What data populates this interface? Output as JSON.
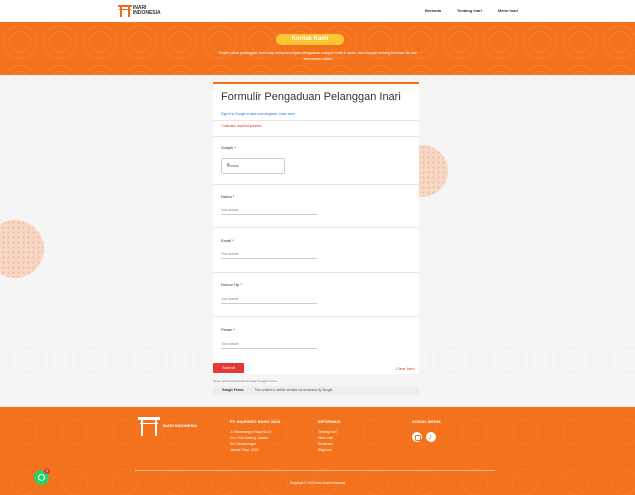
{
  "brand": {
    "name": "INARI INDONESIA"
  },
  "nav": {
    "items": [
      "Beranda",
      "Tentang Inari",
      "Menu Inari"
    ]
  },
  "hero": {
    "title": "Kontak Kami",
    "subtitle": "Sugeh untuk pelanggan, kami siap melayani segala pengaduan maupun kritik & saran, kami sangat senang bertukar ide dan komunikasi dalam"
  },
  "form": {
    "title": "Formulir Pengaduan Pelanggan Inari",
    "signin_text": "Sign in to Google to save your progress. Learn more",
    "required_note": "* Indicates required question",
    "questions": [
      {
        "label": "Subjek *",
        "placeholder": "Choose"
      },
      {
        "label": "Nama *",
        "placeholder": "Your answer"
      },
      {
        "label": "Email *",
        "placeholder": "Your answer"
      },
      {
        "label": "Nomor Hp *",
        "placeholder": "Your answer"
      },
      {
        "label": "Pesan *",
        "placeholder": "Your answer"
      }
    ],
    "submit_label": "Submit",
    "clear_label": "Clear form",
    "never_submit": "Never submit passwords through Google Forms.",
    "google_brand": "Google Forms",
    "google_note": "This content is neither created nor endorsed by Google."
  },
  "footer": {
    "company_heading": "PT. INARINDO BAHU JAYA",
    "address": [
      "Jl. Rawamangun Raya No.10",
      "Kec. Pulo Gadung, Jakarta",
      "Kel. Rawamangun",
      "Jakarta Timur 13220"
    ],
    "information_heading": "INFORMASI",
    "information_links": [
      "Tentang Inari",
      "Menu Inari",
      "Kemitraan",
      "Blog Inari"
    ],
    "social_heading": "SOSIAL MEDIA",
    "social_icons": [
      "instagram-icon",
      "tiktok-icon"
    ],
    "copyright": "Copyright © 2023 Inari Sushi Indonesia"
  },
  "whatsapp": {
    "badge": "1"
  }
}
